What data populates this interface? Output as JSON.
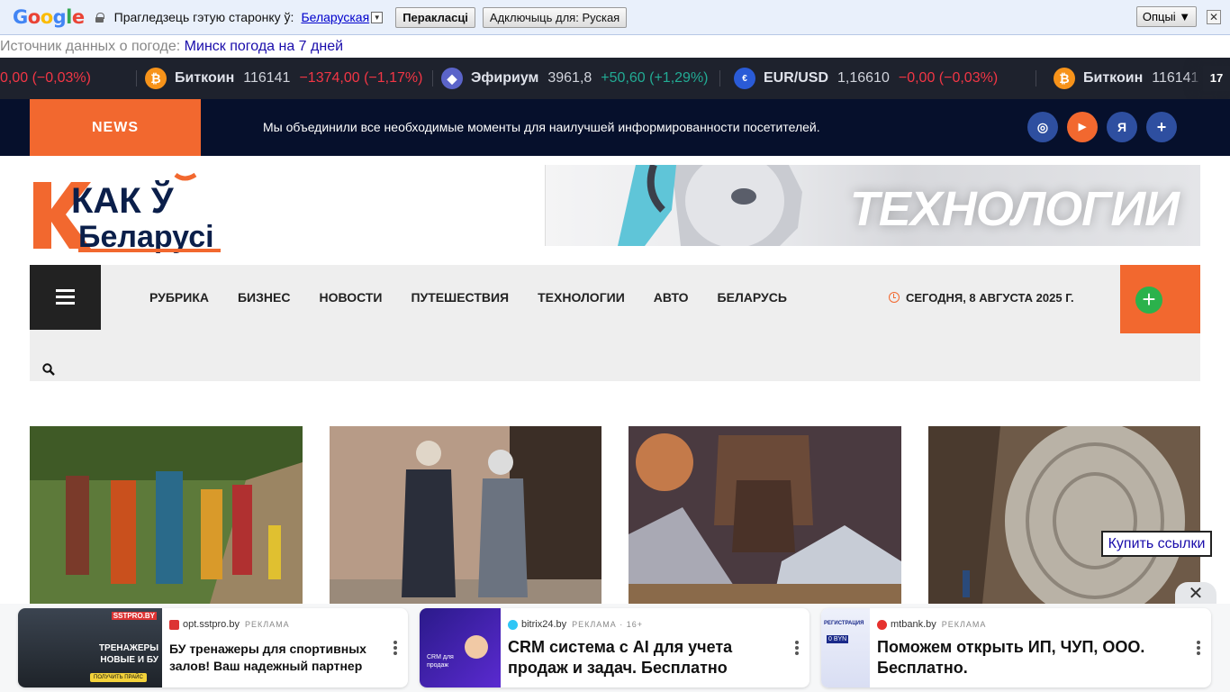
{
  "translate_bar": {
    "logo": [
      "G",
      "o",
      "o",
      "g",
      "l",
      "e"
    ],
    "prompt": "Прагледзець гэтую старонку ў:",
    "language": "Беларуская",
    "dropdown_glyph": "▼",
    "translate_button": "Перакласці",
    "disable_button": "Адключыць для: Руская",
    "options_button": "Опцыі ▼",
    "close_glyph": "✕"
  },
  "weather": {
    "prefix": "Источник данных о погоде:",
    "link": "Минск погода на 7 дней"
  },
  "ticker": {
    "items": [
      {
        "name": "",
        "price": "",
        "change": "0,00 (−0,03%)",
        "trend": "neg",
        "icon": "none"
      },
      {
        "name": "Биткоин",
        "price": "116141",
        "change": "−1374,00 (−1,17%)",
        "trend": "neg",
        "icon": "bitcoin-icon",
        "glyph": "₿"
      },
      {
        "name": "Эфириум",
        "price": "3961,8",
        "change": "+50,60 (+1,29%)",
        "trend": "pos",
        "icon": "ethereum-icon",
        "glyph": "◆"
      },
      {
        "name": "EUR/USD",
        "price": "1,16610",
        "change": "−0,00 (−0,03%)",
        "trend": "neg",
        "icon": "eur-usd-flag-icon",
        "glyph": "€"
      },
      {
        "name": "Биткоин",
        "price": "116141",
        "change": "",
        "trend": "neg",
        "icon": "bitcoin-icon",
        "glyph": "₿"
      }
    ],
    "brand_glyph": "17"
  },
  "news_bar": {
    "label": "NEWS",
    "text": "Мы объединили все необходимые моменты для наилучшей информированности посетителей.",
    "social": [
      {
        "name": "instagram-icon",
        "glyph": "◎"
      },
      {
        "name": "youtube-icon",
        "glyph": "▶"
      },
      {
        "name": "yandex-icon",
        "glyph": "Я"
      },
      {
        "name": "bookmark-plus-icon",
        "glyph": "+"
      }
    ]
  },
  "logo": {
    "line1": "КАК Ў",
    "line2": "Беларусі"
  },
  "banner": {
    "title": "ТЕХНОЛОГИИ"
  },
  "nav": {
    "items": [
      "РУБРИКА",
      "БИЗНЕС",
      "НОВОСТИ",
      "ПУТЕШЕСТВИЯ",
      "ТЕХНОЛОГИИ",
      "АВТО",
      "БЕЛАРУСЬ"
    ],
    "date": "СЕГОДНЯ, 8 АВГУСТА 2025 Г.",
    "plus_glyph": "+"
  },
  "buy_links": "Купить ссылки",
  "ads": {
    "close_glyph": "✕",
    "cards": [
      {
        "domain": "opt.sstpro.by",
        "tag": "РЕКЛАМА",
        "title": "БУ тренажеры для спортивных залов! Ваш надежный партнер",
        "img_text": "ТРЕНАЖЕРЫ НОВЫЕ И БУ",
        "img_btn": "ПОЛУЧИТЬ ПРАЙС",
        "img_brand": "SSTPRO.BY"
      },
      {
        "domain": "bitrix24.by",
        "tag": "РЕКЛАМА · 16+",
        "title": "CRM система с AI для учета продаж и задач. Бесплатно",
        "img_text": "CRM для продаж"
      },
      {
        "domain": "mtbank.by",
        "tag": "РЕКЛАМА",
        "title": "Поможем открыть ИП, ЧУП, ООО. Бесплатно.",
        "img_text": "РЕГИСТРАЦИЯ",
        "img_sub": "0 BYN"
      }
    ]
  }
}
